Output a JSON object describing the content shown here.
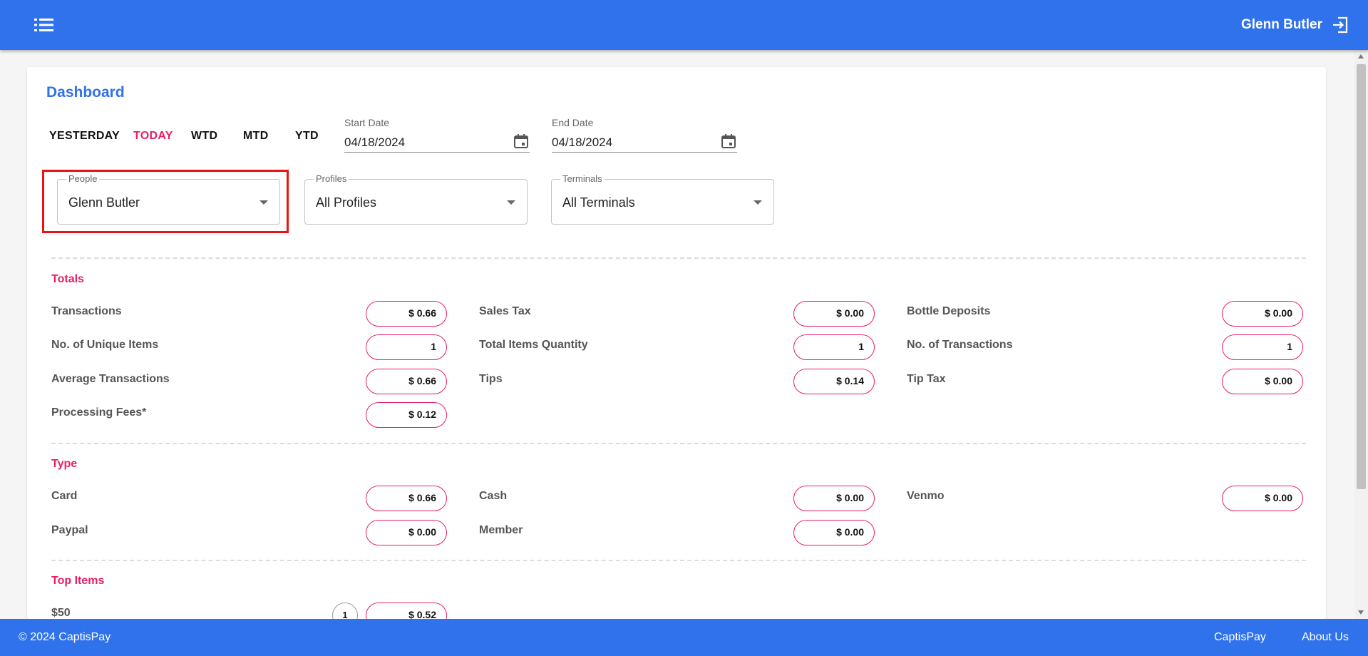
{
  "header": {
    "user_name": "Glenn Butler"
  },
  "page": {
    "title": "Dashboard"
  },
  "date_ranges": [
    "YESTERDAY",
    "TODAY",
    "WTD",
    "MTD",
    "YTD"
  ],
  "active_range": "TODAY",
  "start_date": {
    "label": "Start Date",
    "value": "04/18/2024"
  },
  "end_date": {
    "label": "End Date",
    "value": "04/18/2024"
  },
  "filters": {
    "people": {
      "label": "People",
      "value": "Glenn Butler"
    },
    "profiles": {
      "label": "Profiles",
      "value": "All Profiles"
    },
    "terminals": {
      "label": "Terminals",
      "value": "All Terminals"
    }
  },
  "totals": {
    "title": "Totals",
    "transactions": {
      "label": "Transactions",
      "value": "$ 0.66"
    },
    "sales_tax": {
      "label": "Sales Tax",
      "value": "$ 0.00"
    },
    "bottle_deposits": {
      "label": "Bottle Deposits",
      "value": "$ 0.00"
    },
    "unique_items": {
      "label": "No. of Unique Items",
      "value": "1"
    },
    "total_items_quantity": {
      "label": "Total Items Quantity",
      "value": "1"
    },
    "num_transactions": {
      "label": "No. of Transactions",
      "value": "1"
    },
    "average_transactions": {
      "label": "Average Transactions",
      "value": "$ 0.66"
    },
    "tips": {
      "label": "Tips",
      "value": "$ 0.14"
    },
    "tip_tax": {
      "label": "Tip Tax",
      "value": "$ 0.00"
    },
    "processing_fees": {
      "label": "Processing Fees*",
      "value": "$ 0.12"
    }
  },
  "type": {
    "title": "Type",
    "card": {
      "label": "Card",
      "value": "$ 0.66"
    },
    "cash": {
      "label": "Cash",
      "value": "$ 0.00"
    },
    "venmo": {
      "label": "Venmo",
      "value": "$ 0.00"
    },
    "paypal": {
      "label": "Paypal",
      "value": "$ 0.00"
    },
    "member": {
      "label": "Member",
      "value": "$ 0.00"
    }
  },
  "top_items": {
    "title": "Top Items",
    "items": [
      {
        "label": "$50",
        "count": "1",
        "value": "$ 0.52"
      }
    ]
  },
  "footer": {
    "copyright": "© 2024 CaptisPay",
    "links": [
      "CaptisPay",
      "About Us"
    ]
  },
  "colors": {
    "primary": "#3072eb",
    "accent": "#e91e63",
    "highlight": "#ee1111"
  }
}
